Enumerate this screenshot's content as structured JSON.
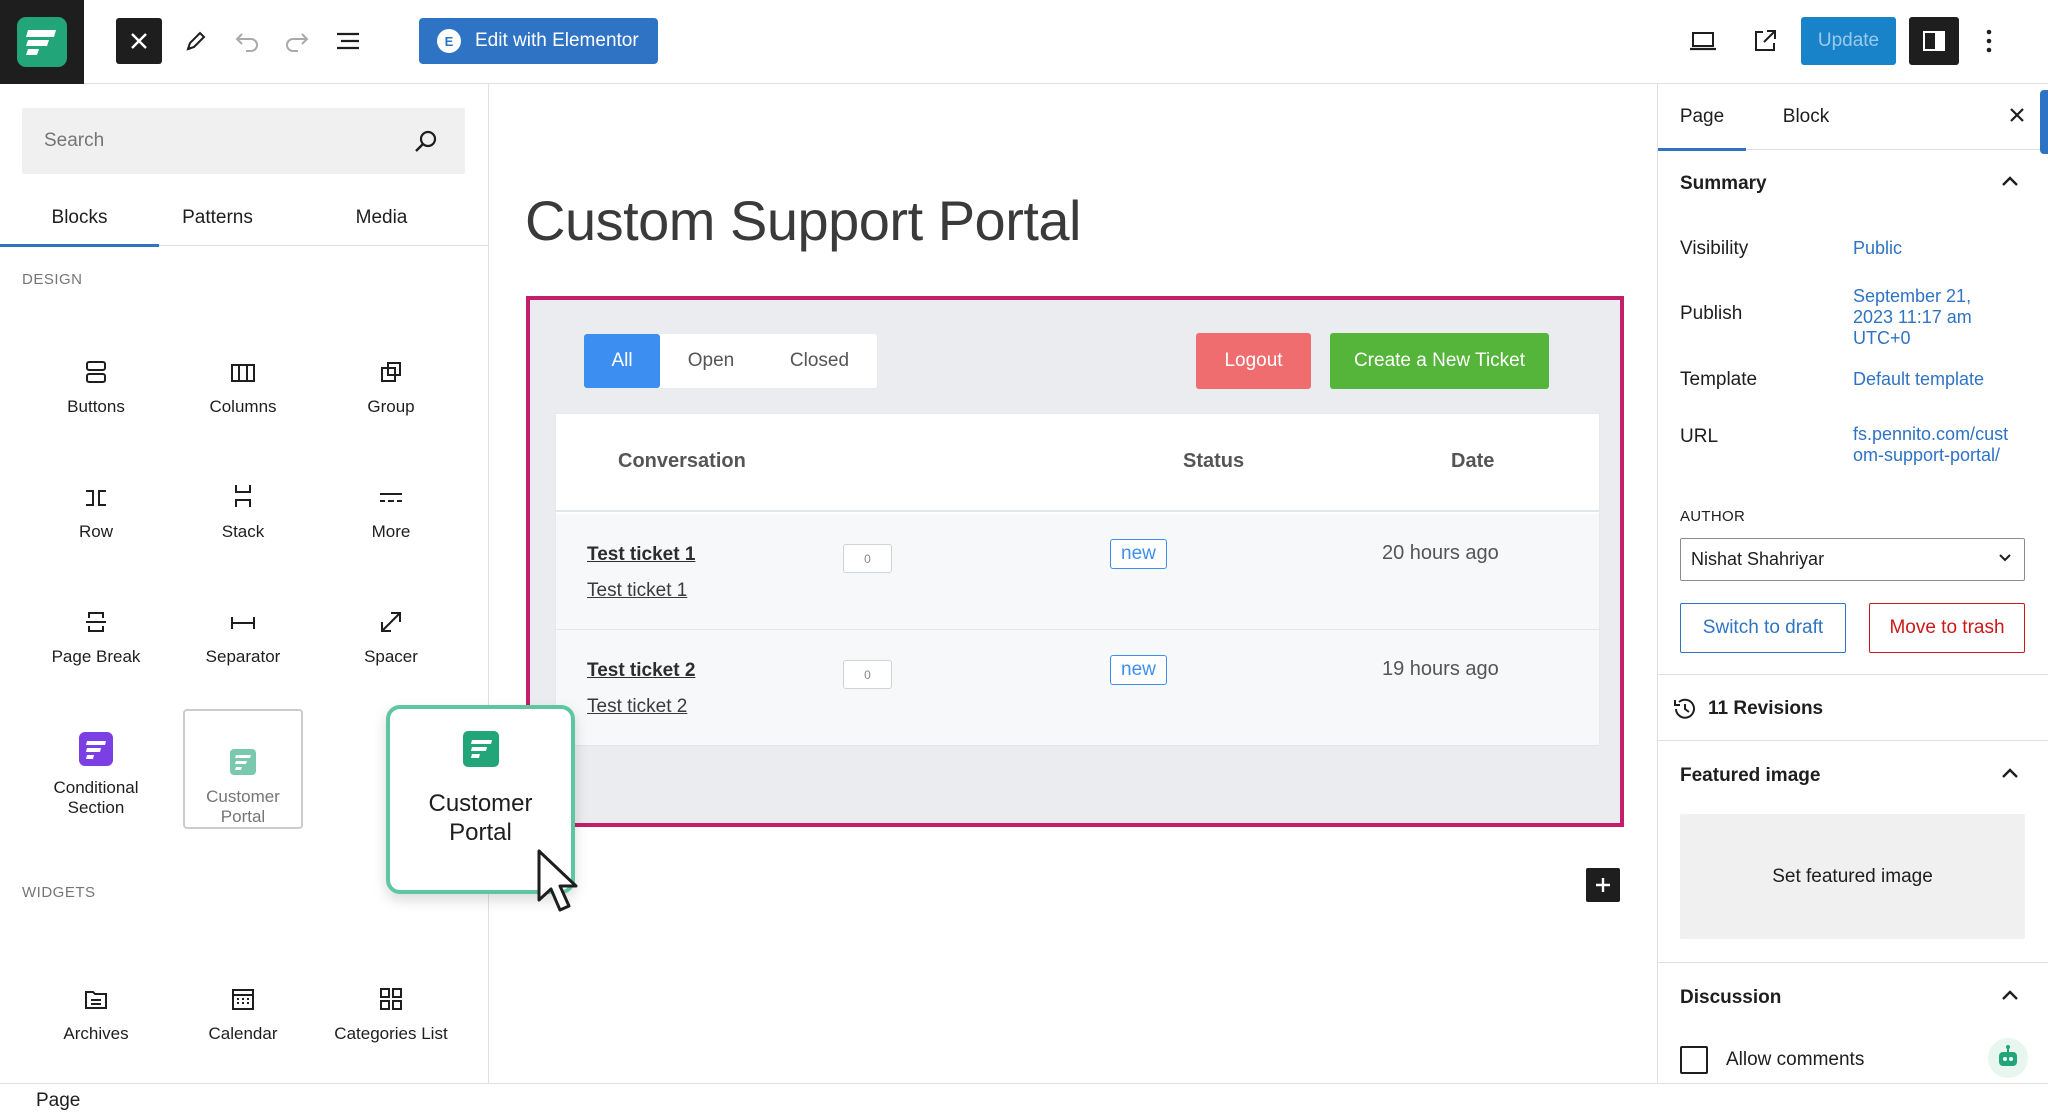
{
  "toolbar": {
    "edit_with_elementor": "Edit with Elementor",
    "update": "Update"
  },
  "inserter": {
    "search_placeholder": "Search",
    "tabs": [
      "Blocks",
      "Patterns",
      "Media"
    ],
    "design_heading": "DESIGN",
    "widgets_heading": "WIDGETS",
    "blocks": {
      "buttons": "Buttons",
      "columns": "Columns",
      "group": "Group",
      "row": "Row",
      "stack": "Stack",
      "more": "More",
      "page_break": "Page Break",
      "separator": "Separator",
      "spacer": "Spacer",
      "conditional_section": "Conditional Section",
      "customer_portal": "Customer Portal",
      "archives": "Archives",
      "calendar": "Calendar",
      "categories_list": "Categories List"
    },
    "drag_preview_label": "Customer Portal"
  },
  "canvas": {
    "page_title": "Custom Support Portal",
    "portal": {
      "filters": [
        "All",
        "Open",
        "Closed"
      ],
      "logout": "Logout",
      "create_ticket": "Create a New Ticket",
      "columns": {
        "conversation": "Conversation",
        "status": "Status",
        "date": "Date"
      },
      "tickets": [
        {
          "title": "Test ticket 1",
          "subtitle": "Test ticket 1",
          "count": "0",
          "status": "new",
          "date": "20 hours ago"
        },
        {
          "title": "Test ticket 2",
          "subtitle": "Test ticket 2",
          "count": "0",
          "status": "new",
          "date": "19 hours ago"
        }
      ]
    }
  },
  "settings": {
    "tabs": [
      "Page",
      "Block"
    ],
    "summary_heading": "Summary",
    "visibility_label": "Visibility",
    "visibility_value": "Public",
    "publish_label": "Publish",
    "publish_value": "September 21, 2023 11:17 am UTC+0",
    "template_label": "Template",
    "template_value": "Default template",
    "url_label": "URL",
    "url_value": "fs.pennito.com/custom-support-portal/",
    "author_heading": "AUTHOR",
    "author_value": "Nishat Shahriyar",
    "switch_to_draft": "Switch to draft",
    "move_to_trash": "Move to trash",
    "revisions": "11 Revisions",
    "featured_image_heading": "Featured image",
    "set_featured_image": "Set featured image",
    "discussion_heading": "Discussion",
    "allow_comments": "Allow comments"
  },
  "footer": {
    "breadcrumb": "Page"
  },
  "colors": {
    "accent": "#2f73c4",
    "portal_border": "#c41e6a",
    "logout": "#f06d6f",
    "create_ticket": "#55b43a",
    "filter_active": "#3c8ff0",
    "brand": "#22a578"
  },
  "icons": [
    "logo-icon",
    "close-icon",
    "pen-icon",
    "undo-icon",
    "redo-icon",
    "list-view-icon",
    "elementor-icon",
    "desktop-preview-icon",
    "external-link-icon",
    "sidebar-toggle-icon",
    "kebab-icon",
    "search-icon",
    "chevron-up-icon",
    "chevron-down-icon",
    "history-icon",
    "plus-icon",
    "robot-icon",
    "cursor-icon"
  ]
}
